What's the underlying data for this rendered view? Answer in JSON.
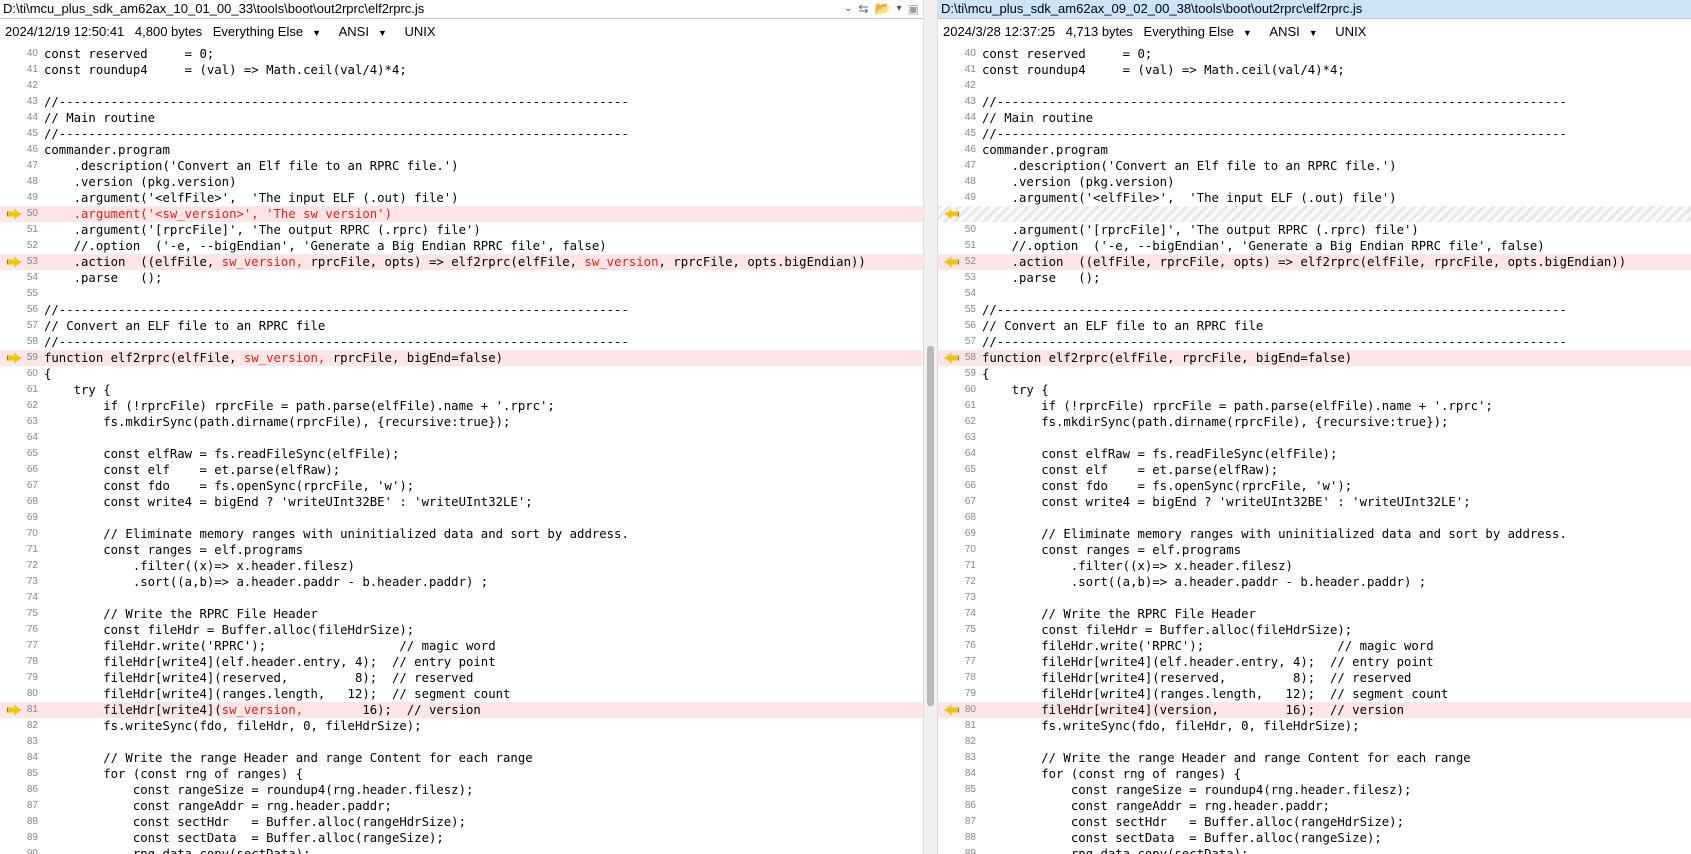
{
  "left": {
    "path": "D:\\ti\\mcu_plus_sdk_am62ax_10_01_00_33\\tools\\boot\\out2rprc\\elf2rprc.js",
    "date": "2024/12/19 12:50:41",
    "size": "4,800 bytes",
    "format": "Everything Else",
    "encoding": "ANSI",
    "eol": "UNIX",
    "lines": [
      {
        "n": "40",
        "segs": [
          {
            "t": "const reserved     = 0;"
          }
        ]
      },
      {
        "n": "41",
        "segs": [
          {
            "t": "const roundup4     = (val) => Math.ceil(val/4)*4;"
          }
        ]
      },
      {
        "n": "42",
        "segs": []
      },
      {
        "n": "43",
        "segs": [
          {
            "t": "//-----------------------------------------------------------------------------"
          }
        ]
      },
      {
        "n": "44",
        "segs": [
          {
            "t": "// Main routine"
          }
        ]
      },
      {
        "n": "45",
        "segs": [
          {
            "t": "//-----------------------------------------------------------------------------"
          }
        ]
      },
      {
        "n": "46",
        "segs": [
          {
            "t": "commander.program"
          }
        ]
      },
      {
        "n": "47",
        "segs": [
          {
            "t": "    .description('Convert an Elf file to an RPRC file.')"
          }
        ]
      },
      {
        "n": "48",
        "segs": [
          {
            "t": "    .version (pkg.version)"
          }
        ]
      },
      {
        "n": "49",
        "segs": [
          {
            "t": "    .argument('<elfFile>',  'The input ELF (.out) file')"
          }
        ]
      },
      {
        "n": "50",
        "diff": true,
        "segs": [
          {
            "t": "    "
          },
          {
            "t": ".argument('<sw_version>', 'The sw version')",
            "h": true
          }
        ]
      },
      {
        "n": "51",
        "segs": [
          {
            "t": "    .argument('[rprcFile]', 'The output RPRC (.rprc) file')"
          }
        ]
      },
      {
        "n": "52",
        "segs": [
          {
            "t": "    //.option  ('-e, --bigEndian', 'Generate a Big Endian RPRC file', false)"
          }
        ]
      },
      {
        "n": "53",
        "diff": true,
        "segs": [
          {
            "t": "    .action  ((elfFile, "
          },
          {
            "t": "sw_version,",
            "h": true
          },
          {
            "t": " rprcFile, opts) => elf2rprc(elfFile, "
          },
          {
            "t": "sw_version",
            "h": true
          },
          {
            "t": ", rprcFile, opts.bigEndian))"
          }
        ]
      },
      {
        "n": "54",
        "segs": [
          {
            "t": "    .parse   ();"
          }
        ]
      },
      {
        "n": "55",
        "segs": []
      },
      {
        "n": "56",
        "segs": [
          {
            "t": "//-----------------------------------------------------------------------------"
          }
        ]
      },
      {
        "n": "57",
        "segs": [
          {
            "t": "// Convert an ELF file to an RPRC file"
          }
        ]
      },
      {
        "n": "58",
        "segs": [
          {
            "t": "//-----------------------------------------------------------------------------"
          }
        ]
      },
      {
        "n": "59",
        "diff": true,
        "segs": [
          {
            "t": "function elf2rprc(elfFile, "
          },
          {
            "t": "sw_version,",
            "h": true
          },
          {
            "t": " rprcFile, bigEnd=false)"
          }
        ]
      },
      {
        "n": "60",
        "segs": [
          {
            "t": "{"
          }
        ]
      },
      {
        "n": "61",
        "segs": [
          {
            "t": "    try {"
          }
        ]
      },
      {
        "n": "62",
        "segs": [
          {
            "t": "        if (!rprcFile) rprcFile = path.parse(elfFile).name + '.rprc';"
          }
        ]
      },
      {
        "n": "63",
        "segs": [
          {
            "t": "        fs.mkdirSync(path.dirname(rprcFile), {recursive:true});"
          }
        ]
      },
      {
        "n": "64",
        "segs": []
      },
      {
        "n": "65",
        "segs": [
          {
            "t": "        const elfRaw = fs.readFileSync(elfFile);"
          }
        ]
      },
      {
        "n": "66",
        "segs": [
          {
            "t": "        const elf    = et.parse(elfRaw);"
          }
        ]
      },
      {
        "n": "67",
        "segs": [
          {
            "t": "        const fdo    = fs.openSync(rprcFile, 'w');"
          }
        ]
      },
      {
        "n": "68",
        "segs": [
          {
            "t": "        const write4 = bigEnd ? 'writeUInt32BE' : 'writeUInt32LE';"
          }
        ]
      },
      {
        "n": "69",
        "segs": []
      },
      {
        "n": "70",
        "segs": [
          {
            "t": "        // Eliminate memory ranges with uninitialized data and sort by address."
          }
        ]
      },
      {
        "n": "71",
        "segs": [
          {
            "t": "        const ranges = elf.programs"
          }
        ]
      },
      {
        "n": "72",
        "segs": [
          {
            "t": "            .filter((x)=> x.header.filesz)"
          }
        ]
      },
      {
        "n": "73",
        "segs": [
          {
            "t": "            .sort((a,b)=> a.header.paddr - b.header.paddr) ;"
          }
        ]
      },
      {
        "n": "74",
        "segs": []
      },
      {
        "n": "75",
        "segs": [
          {
            "t": "        // Write the RPRC File Header"
          }
        ]
      },
      {
        "n": "76",
        "segs": [
          {
            "t": "        const fileHdr = Buffer.alloc(fileHdrSize);"
          }
        ]
      },
      {
        "n": "77",
        "segs": [
          {
            "t": "        fileHdr.write('RPRC');                  // magic word"
          }
        ]
      },
      {
        "n": "78",
        "segs": [
          {
            "t": "        fileHdr[write4](elf.header.entry, 4);  // entry point"
          }
        ]
      },
      {
        "n": "79",
        "segs": [
          {
            "t": "        fileHdr[write4](reserved,         8);  // reserved"
          }
        ]
      },
      {
        "n": "80",
        "segs": [
          {
            "t": "        fileHdr[write4](ranges.length,   12);  // segment count"
          }
        ]
      },
      {
        "n": "81",
        "diff": true,
        "segs": [
          {
            "t": "        fileHdr[write4]("
          },
          {
            "t": "sw_version,",
            "h": true
          },
          {
            "t": "        16);  // version"
          }
        ]
      },
      {
        "n": "82",
        "segs": [
          {
            "t": "        fs.writeSync(fdo, fileHdr, 0, fileHdrSize);"
          }
        ]
      },
      {
        "n": "83",
        "segs": []
      },
      {
        "n": "84",
        "segs": [
          {
            "t": "        // Write the range Header and range Content for each range"
          }
        ]
      },
      {
        "n": "85",
        "segs": [
          {
            "t": "        for (const rng of ranges) {"
          }
        ]
      },
      {
        "n": "86",
        "segs": [
          {
            "t": "            const rangeSize = roundup4(rng.header.filesz);"
          }
        ]
      },
      {
        "n": "87",
        "segs": [
          {
            "t": "            const rangeAddr = rng.header.paddr;"
          }
        ]
      },
      {
        "n": "88",
        "segs": [
          {
            "t": "            const sectHdr   = Buffer.alloc(rangeHdrSize);"
          }
        ]
      },
      {
        "n": "89",
        "segs": [
          {
            "t": "            const sectData  = Buffer.alloc(rangeSize);"
          }
        ]
      },
      {
        "n": "90",
        "segs": [
          {
            "t": "            rng.data.copy(sectData);"
          }
        ]
      }
    ]
  },
  "right": {
    "path": "D:\\ti\\mcu_plus_sdk_am62ax_09_02_00_38\\tools\\boot\\out2rprc\\elf2rprc.js",
    "date": "2024/3/28 12:37:25",
    "size": "4,713 bytes",
    "format": "Everything Else",
    "encoding": "ANSI",
    "eol": "UNIX",
    "lines": [
      {
        "n": "40",
        "segs": [
          {
            "t": "const reserved     = 0;"
          }
        ]
      },
      {
        "n": "41",
        "segs": [
          {
            "t": "const roundup4     = (val) => Math.ceil(val/4)*4;"
          }
        ]
      },
      {
        "n": "42",
        "segs": []
      },
      {
        "n": "43",
        "segs": [
          {
            "t": "//-----------------------------------------------------------------------------"
          }
        ]
      },
      {
        "n": "44",
        "segs": [
          {
            "t": "// Main routine"
          }
        ]
      },
      {
        "n": "45",
        "segs": [
          {
            "t": "//-----------------------------------------------------------------------------"
          }
        ]
      },
      {
        "n": "46",
        "segs": [
          {
            "t": "commander.program"
          }
        ]
      },
      {
        "n": "47",
        "segs": [
          {
            "t": "    .description('Convert an Elf file to an RPRC file.')"
          }
        ]
      },
      {
        "n": "48",
        "segs": [
          {
            "t": "    .version (pkg.version)"
          }
        ]
      },
      {
        "n": "49",
        "segs": [
          {
            "t": "    .argument('<elfFile>',  'The input ELF (.out) file')"
          }
        ]
      },
      {
        "n": "",
        "gap": true,
        "segs": []
      },
      {
        "n": "50",
        "segs": [
          {
            "t": "    .argument('[rprcFile]', 'The output RPRC (.rprc) file')"
          }
        ]
      },
      {
        "n": "51",
        "segs": [
          {
            "t": "    //.option  ('-e, --bigEndian', 'Generate a Big Endian RPRC file', false)"
          }
        ]
      },
      {
        "n": "52",
        "diff": true,
        "segs": [
          {
            "t": "    .action  ((elfFile, rprcFile, opts) => elf2rprc(elfFile, rprcFile, opts.bigEndian))"
          }
        ]
      },
      {
        "n": "53",
        "segs": [
          {
            "t": "    .parse   ();"
          }
        ]
      },
      {
        "n": "54",
        "segs": []
      },
      {
        "n": "55",
        "segs": [
          {
            "t": "//-----------------------------------------------------------------------------"
          }
        ]
      },
      {
        "n": "56",
        "segs": [
          {
            "t": "// Convert an ELF file to an RPRC file"
          }
        ]
      },
      {
        "n": "57",
        "segs": [
          {
            "t": "//-----------------------------------------------------------------------------"
          }
        ]
      },
      {
        "n": "58",
        "diff": true,
        "segs": [
          {
            "t": "function elf2rprc(elfFile, rprcFile, bigEnd=false)"
          }
        ]
      },
      {
        "n": "59",
        "segs": [
          {
            "t": "{"
          }
        ]
      },
      {
        "n": "60",
        "segs": [
          {
            "t": "    try {"
          }
        ]
      },
      {
        "n": "61",
        "segs": [
          {
            "t": "        if (!rprcFile) rprcFile = path.parse(elfFile).name + '.rprc';"
          }
        ]
      },
      {
        "n": "62",
        "segs": [
          {
            "t": "        fs.mkdirSync(path.dirname(rprcFile), {recursive:true});"
          }
        ]
      },
      {
        "n": "63",
        "segs": []
      },
      {
        "n": "64",
        "segs": [
          {
            "t": "        const elfRaw = fs.readFileSync(elfFile);"
          }
        ]
      },
      {
        "n": "65",
        "segs": [
          {
            "t": "        const elf    = et.parse(elfRaw);"
          }
        ]
      },
      {
        "n": "66",
        "segs": [
          {
            "t": "        const fdo    = fs.openSync(rprcFile, 'w');"
          }
        ]
      },
      {
        "n": "67",
        "segs": [
          {
            "t": "        const write4 = bigEnd ? 'writeUInt32BE' : 'writeUInt32LE';"
          }
        ]
      },
      {
        "n": "68",
        "segs": []
      },
      {
        "n": "69",
        "segs": [
          {
            "t": "        // Eliminate memory ranges with uninitialized data and sort by address."
          }
        ]
      },
      {
        "n": "70",
        "segs": [
          {
            "t": "        const ranges = elf.programs"
          }
        ]
      },
      {
        "n": "71",
        "segs": [
          {
            "t": "            .filter((x)=> x.header.filesz)"
          }
        ]
      },
      {
        "n": "72",
        "segs": [
          {
            "t": "            .sort((a,b)=> a.header.paddr - b.header.paddr) ;"
          }
        ]
      },
      {
        "n": "73",
        "segs": []
      },
      {
        "n": "74",
        "segs": [
          {
            "t": "        // Write the RPRC File Header"
          }
        ]
      },
      {
        "n": "75",
        "segs": [
          {
            "t": "        const fileHdr = Buffer.alloc(fileHdrSize);"
          }
        ]
      },
      {
        "n": "76",
        "segs": [
          {
            "t": "        fileHdr.write('RPRC');                  // magic word"
          }
        ]
      },
      {
        "n": "77",
        "segs": [
          {
            "t": "        fileHdr[write4](elf.header.entry, 4);  // entry point"
          }
        ]
      },
      {
        "n": "78",
        "segs": [
          {
            "t": "        fileHdr[write4](reserved,         8);  // reserved"
          }
        ]
      },
      {
        "n": "79",
        "segs": [
          {
            "t": "        fileHdr[write4](ranges.length,   12);  // segment count"
          }
        ]
      },
      {
        "n": "80",
        "diff": true,
        "segs": [
          {
            "t": "        fileHdr[write4](version,         16);  // version"
          }
        ]
      },
      {
        "n": "81",
        "segs": [
          {
            "t": "        fs.writeSync(fdo, fileHdr, 0, fileHdrSize);"
          }
        ]
      },
      {
        "n": "82",
        "segs": []
      },
      {
        "n": "83",
        "segs": [
          {
            "t": "        // Write the range Header and range Content for each range"
          }
        ]
      },
      {
        "n": "84",
        "segs": [
          {
            "t": "        for (const rng of ranges) {"
          }
        ]
      },
      {
        "n": "85",
        "segs": [
          {
            "t": "            const rangeSize = roundup4(rng.header.filesz);"
          }
        ]
      },
      {
        "n": "86",
        "segs": [
          {
            "t": "            const rangeAddr = rng.header.paddr;"
          }
        ]
      },
      {
        "n": "87",
        "segs": [
          {
            "t": "            const sectHdr   = Buffer.alloc(rangeHdrSize);"
          }
        ]
      },
      {
        "n": "88",
        "segs": [
          {
            "t": "            const sectData  = Buffer.alloc(rangeSize);"
          }
        ]
      },
      {
        "n": "89",
        "segs": [
          {
            "t": "            rng.data.copy(sectData);"
          }
        ]
      }
    ]
  }
}
